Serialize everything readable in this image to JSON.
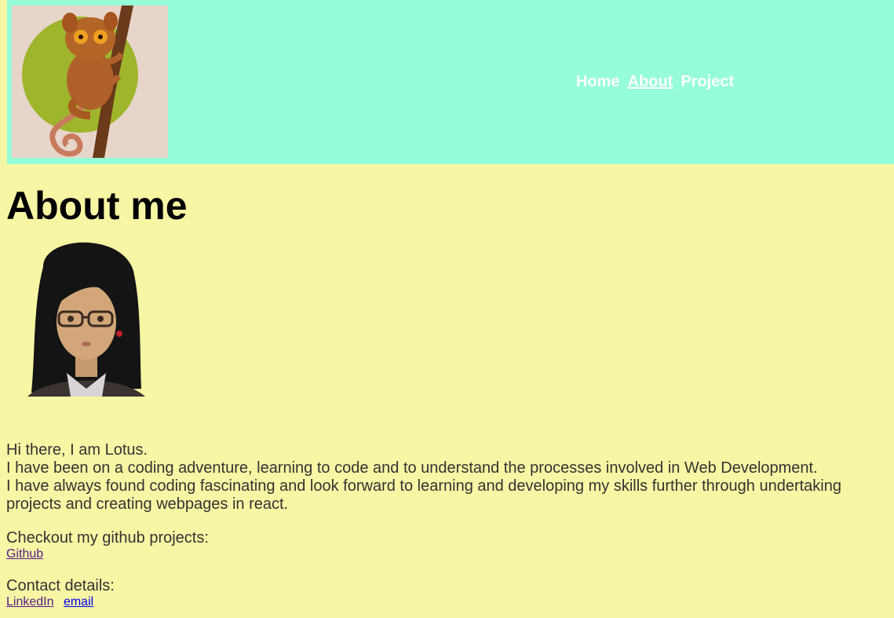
{
  "header": {
    "logo_alt": "tarsier illustration",
    "nav": [
      {
        "label": "Home",
        "active": false
      },
      {
        "label": "About",
        "active": true
      },
      {
        "label": "Project",
        "active": false
      }
    ]
  },
  "main": {
    "title": "About me",
    "bio_lines": [
      "Hi there, I am Lotus.",
      "I have been on a coding adventure, learning to code and to understand the processes involved in Web Development.",
      "I have always found coding fascinating and look forward to learning and developing my skills further through undertaking projects and creating webpages in react."
    ],
    "github_label": "Checkout my github projects:",
    "github_link": "Github",
    "contact_label": "Contact details:",
    "linkedin_link": "LinkedIn",
    "email_link": "email"
  },
  "colors": {
    "header_bg": "#96fdd9",
    "page_bg": "#f7f6a4",
    "nav_text": "#ffffff"
  }
}
